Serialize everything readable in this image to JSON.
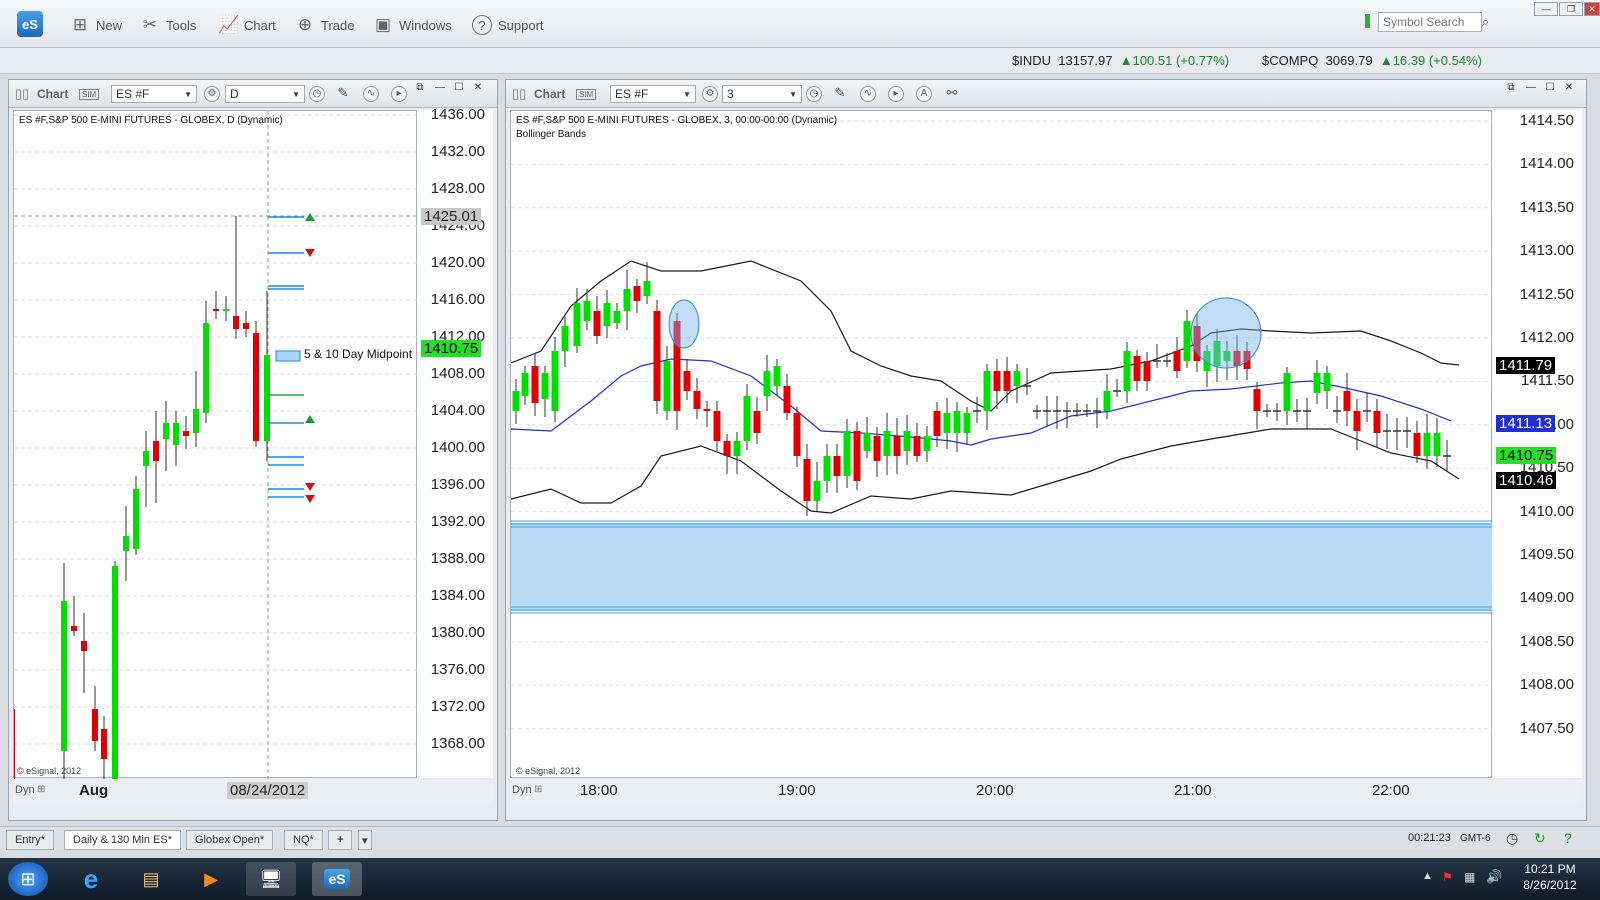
{
  "toolbar": {
    "new": "New",
    "tools": "Tools",
    "chart": "Chart",
    "trade": "Trade",
    "windows": "Windows",
    "support": "Support",
    "logo": "eS",
    "search_placeholder": "Symbol Search"
  },
  "ticker": {
    "indu_sym": "$INDU",
    "indu_val": "13157.97",
    "indu_chg": "100.51 (+0.77%)",
    "comp_sym": "$COMPQ",
    "comp_val": "3069.79",
    "comp_chg": "16.39 (+0.54%)",
    "up_color": "#1a8a2a"
  },
  "left": {
    "title": "Chart",
    "sim": "SIM",
    "symbol": "ES #F",
    "interval": "D",
    "desc": "ES #F,S&P 500 E-MINI FUTURES - GLOBEX, D (Dynamic)",
    "annotation": "5 & 10 Day Midpoint",
    "copyright": "© eSignal, 2012",
    "dyn": "Dyn",
    "month": "Aug",
    "date": "08/24/2012",
    "y_ticks": [
      "1436.00",
      "1432.00",
      "1428.00",
      "1424.00",
      "1420.00",
      "1416.00",
      "1412.00",
      "1408.00",
      "1404.00",
      "1400.00",
      "1396.00",
      "1392.00",
      "1388.00",
      "1384.00",
      "1380.00",
      "1376.00",
      "1372.00",
      "1368.00"
    ],
    "tag_hi": "1425.01",
    "tag_last": "1410.75"
  },
  "right": {
    "title": "Chart",
    "sim": "SIM",
    "symbol": "ES #F",
    "interval": "3",
    "desc": "ES #F,S&P 500 E-MINI FUTURES - GLOBEX, 3, 00:00-00:00 (Dynamic)",
    "study": "Bollinger Bands",
    "copyright": "© eSignal, 2012",
    "dyn": "Dyn",
    "y_ticks": [
      "1414.50",
      "1414.00",
      "1413.50",
      "1413.00",
      "1412.50",
      "1412.00",
      "1411.50",
      "1411.00",
      "1410.50",
      "1410.00",
      "1409.50",
      "1409.00",
      "1408.50",
      "1408.00",
      "1407.50"
    ],
    "x_ticks": [
      "18:00",
      "19:00",
      "20:00",
      "21:00",
      "22:00"
    ],
    "tag_upper": "1411.79",
    "tag_mid": "1411.13",
    "tag_last": "1410.75",
    "tag_lower": "1410.46"
  },
  "tabs": [
    "Entry*",
    "Daily & 130 Min ES*",
    "Globex Open*",
    "NQ*"
  ],
  "status": {
    "clock": "00:21:23",
    "tz": "GMT-6"
  },
  "tray": {
    "time": "10:21 PM",
    "date": "8/26/2012"
  },
  "colors": {
    "up": "#00e000",
    "down": "#e00000",
    "band": "#1a1a1a",
    "mid": "#1f2fd8",
    "zone": "#b8dcf7",
    "zone_line": "#3aa0e8"
  }
}
